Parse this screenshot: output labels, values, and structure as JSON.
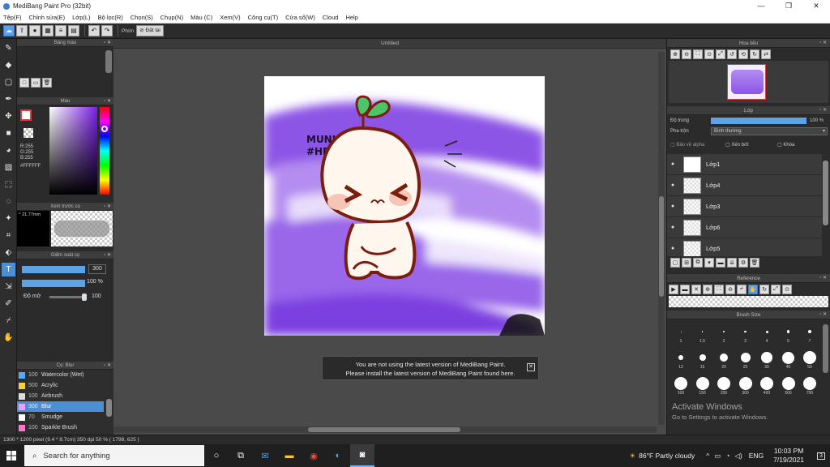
{
  "titlebar": {
    "title": "MediBang Paint Pro (32bit)",
    "minimize": "—",
    "maximize": "❐",
    "close": "✕"
  },
  "menu": {
    "items": [
      "Tệp(F)",
      "Chỉnh sửa(E)",
      "Lớp(L)",
      "Bộ lọc(R)",
      "Chọn(S)",
      "Chụp(N)",
      "Màu (C)",
      "Xem(V)",
      "Công cụ(T)",
      "Cửa sổ(W)",
      "Cloud",
      "Help"
    ]
  },
  "toolbar": {
    "brush_label": "Phím",
    "reset_label": "Đặt lại"
  },
  "panels": {
    "palette": {
      "title": "Bảng màu"
    },
    "color": {
      "title": "Màu",
      "r": "R:255",
      "g": "G:255",
      "b": "B:255",
      "hex": "#FFFFFF"
    },
    "preview": {
      "title": "Xem trước cọ",
      "size": "^ 21.77mm"
    },
    "brush_settings": {
      "title": "Giếm soát cọ",
      "size_value": "300",
      "opacity_value": "100 %",
      "blur_label": "Độ mờ",
      "blur_value": "100"
    },
    "brush_list": {
      "title": "Cọ: Blur",
      "items": [
        {
          "size": "100",
          "name": "Watercolor (Wet)",
          "color": "#55aaff"
        },
        {
          "size": "500",
          "name": "Acrylic",
          "color": "#f4d03f"
        },
        {
          "size": "100",
          "name": "Airbrush",
          "color": "#dddddd"
        },
        {
          "size": "300",
          "name": "Blur",
          "color": "#e8a0ff"
        },
        {
          "size": "70",
          "name": "Smudge",
          "color": "#ffffff"
        },
        {
          "size": "100",
          "name": "Sparkle Brush",
          "color": "#ff77cc"
        }
      ]
    }
  },
  "canvas": {
    "tab": "Untitled",
    "art_text_line1": "MUNUWU",
    "art_text_line2": "#HD247"
  },
  "notification": {
    "line1": "You are not using the latest version of MediBang Paint.",
    "line2": "Please install the latest version of MediBang Paint found here.",
    "close": "✕"
  },
  "navigator": {
    "title": "Hoa tiêu"
  },
  "layers": {
    "title": "Lớp",
    "opacity_label": "Độ trong",
    "opacity_value": "100 %",
    "blend_label": "Pha trộn",
    "blend_value": "Bình thường",
    "protect_alpha": "Bảo vệ alpha",
    "clipping": "Xén bớt",
    "lock": "Khóa",
    "items": [
      {
        "name": "Lớp1"
      },
      {
        "name": "Lớp4"
      },
      {
        "name": "Lớp3"
      },
      {
        "name": "Lớp6"
      },
      {
        "name": "Lớp5"
      }
    ]
  },
  "reference": {
    "title": "Reference"
  },
  "brush_size": {
    "title": "Brush Size",
    "row1": [
      "1",
      "1.5",
      "2",
      "3",
      "4",
      "5",
      "7"
    ],
    "row2": [
      "12",
      "15",
      "20",
      "25",
      "30",
      "40",
      "50"
    ],
    "row3": [
      "100",
      "150",
      "200",
      "300",
      "400",
      "500",
      "700"
    ]
  },
  "watermark": {
    "line1": "Activate Windows",
    "line2": "Go to Settings to activate Windows."
  },
  "statusbar": {
    "text": "1300 * 1200 pixel   (9.4 * 8.7cm)   350 dpi   50 %   ( 1798, 625 )"
  },
  "taskbar": {
    "search": "Search for anything",
    "weather": "86°F  Partly cloudy",
    "lang": "ENG",
    "time": "10:03 PM",
    "date": "7/19/2021",
    "notifications": "3"
  }
}
